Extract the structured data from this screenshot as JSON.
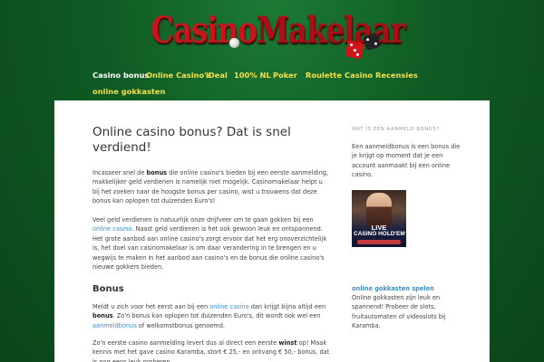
{
  "logo": {
    "part1": "Casino",
    "part2": "Makelaar"
  },
  "nav": {
    "items": [
      {
        "label": "Casino bonus"
      },
      {
        "label": "Online Casino's"
      },
      {
        "label": "iDeal"
      },
      {
        "label": "100% NL"
      },
      {
        "label": "Poker"
      },
      {
        "label": "Roulette"
      },
      {
        "label": "Casino Recensies"
      },
      {
        "label": "online gokkasten"
      }
    ]
  },
  "main": {
    "title": "Online casino bonus? Dat is snel verdiend!",
    "p1": {
      "a": "Incasseer snel de ",
      "b": "bonus",
      "c": " die online casino's bieden bij een eerste aanmelding, makkelijker geld verdienen is namelijk niet mogelijk. Casinomakelaar helpt u bij het zoeken naar de hoogste bonus per casino, wist u trouwens dat deze bonus kan oplopen tot duizenden Euro's!"
    },
    "p2": {
      "a": "Veel geld verdienen is natuurlijk onze drijfveer om te gaan gokken bij een ",
      "link": "online casino",
      "b": ". Naast geld verdienen is het ook gewoon leuk en ontspannend. Het grote aanbod aan online casino's zorgt ervoor dat het erg onoverzichtelijk is, het doel van casinomakelaar is om daar verandering in te brengen en u wegwijs te maken in het aanbod aan casino's en de bonus die online casino's nieuwe gokkers bieden."
    },
    "h2": "Bonus",
    "p3": {
      "a": "Meldt u zich voor het eerst aan bij een ",
      "link1": "online casino",
      "b": " dan krijgt bijna altijd een ",
      "bold": "bonus",
      "c": ". Zo'n bonus kan oplopen tot duizenden Euro's, dit wordt ook wel een ",
      "link2": "aanmeldbonus",
      "d": " of welkomstbonus genoemd."
    },
    "p4": {
      "a": "Zo'n eerste casino aanmelding levert dus al direct een eerste ",
      "bold": "winst",
      "b": " op! Maak kennis met het gave casino Karamba, stort € 25,- en ontvang € 50,- bonus, dat is nog eens leuk proberen."
    }
  },
  "sidebar": {
    "heading": "Wat is een aanmeld bonus?",
    "text1": "Een aanmeldbonus is een bonus die je krijgt op moment dat je een account aanmaakt bij een online casino.",
    "banner": {
      "line1": "LIVE",
      "line2": "CASINO HOLD'EM"
    },
    "link": "online gokkasten spelen",
    "text2": "Online gokkasten zijn leuk en spannend! Probeer de slots, fruitautomaten of videoslots bij Karamba."
  }
}
